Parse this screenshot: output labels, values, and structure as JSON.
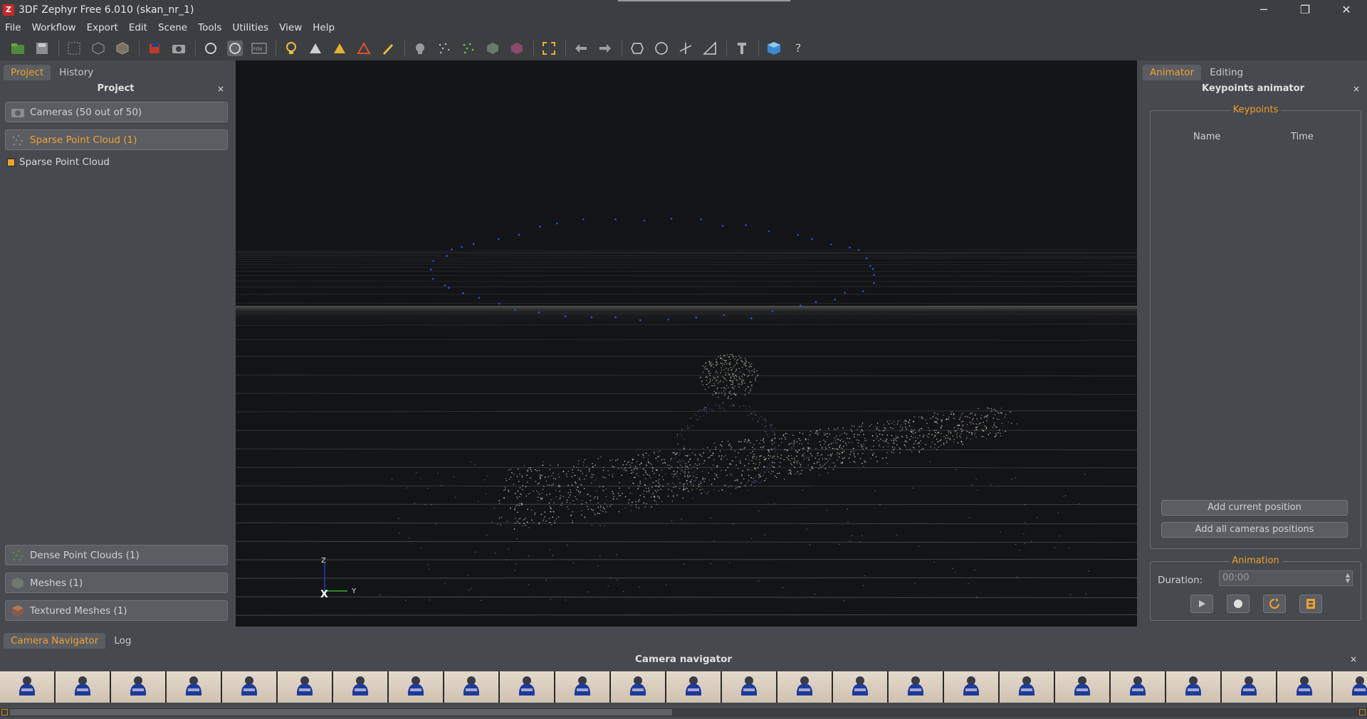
{
  "window": {
    "title": "3DF Zephyr Free 6.010 (skan_nr_1)",
    "controls": {
      "minimize": "─",
      "restore": "❐",
      "close": "✕"
    }
  },
  "menu": [
    "File",
    "Workflow",
    "Export",
    "Edit",
    "Scene",
    "Tools",
    "Utilities",
    "View",
    "Help"
  ],
  "toolbar_icons": [
    "new-project-icon",
    "save-icon",
    "select-region-icon",
    "cube-view-icon",
    "cube-alt-icon",
    "color-cube-icon",
    "camera-icon",
    "orbit-icon",
    "orbit-active-icon",
    "fov-icon",
    "light-icon",
    "triangle-icon",
    "triangle-yellow-icon",
    "triangle-red-icon",
    "brush-icon",
    "filter-icon",
    "points-icon",
    "points-green-icon",
    "box-icon",
    "box-color-icon",
    "fit-view-icon",
    "undo-icon",
    "redo-icon",
    "shape-icon",
    "sphere-icon",
    "plane-icon",
    "ruler-icon",
    "tool-icon",
    "cube-blue-icon"
  ],
  "toolbar_help": "?",
  "left_panel": {
    "tabs": [
      "Project",
      "History"
    ],
    "header": "Project",
    "close": "×",
    "groups_top": [
      {
        "label": "Cameras (50 out of 50)",
        "icon": "camera-group-icon",
        "selected": false
      },
      {
        "label": "Sparse Point Cloud (1)",
        "icon": "sparse-cloud-icon",
        "selected": true
      }
    ],
    "tree_item": "Sparse Point Cloud",
    "groups_bottom": [
      {
        "label": "Dense Point Clouds (1)",
        "icon": "dense-cloud-icon"
      },
      {
        "label": "Meshes (1)",
        "icon": "mesh-icon"
      },
      {
        "label": "Textured Meshes (1)",
        "icon": "textured-mesh-icon"
      }
    ]
  },
  "viewport": {
    "axis_labels": {
      "z": "Z",
      "x": "X",
      "y": "Y"
    }
  },
  "right_panel": {
    "tabs": [
      "Animator",
      "Editing"
    ],
    "header": "Keypoints animator",
    "close": "×",
    "keypoints": {
      "title": "Keypoints",
      "columns": [
        "Name",
        "Time"
      ],
      "add_current": "Add current position",
      "add_all": "Add all cameras positions"
    },
    "animation": {
      "title": "Animation",
      "duration_label": "Duration:",
      "duration_value": "00:00"
    }
  },
  "bottom": {
    "tabs": [
      "Camera Navigator",
      "Log"
    ],
    "header": "Camera navigator",
    "close": "×",
    "thumbnail_count": 25
  },
  "colors": {
    "accent": "#f0a030",
    "panel": "#46494d",
    "chrome": "#3c3f41",
    "viewport": "#131416",
    "camera_points": "#3050d0"
  }
}
